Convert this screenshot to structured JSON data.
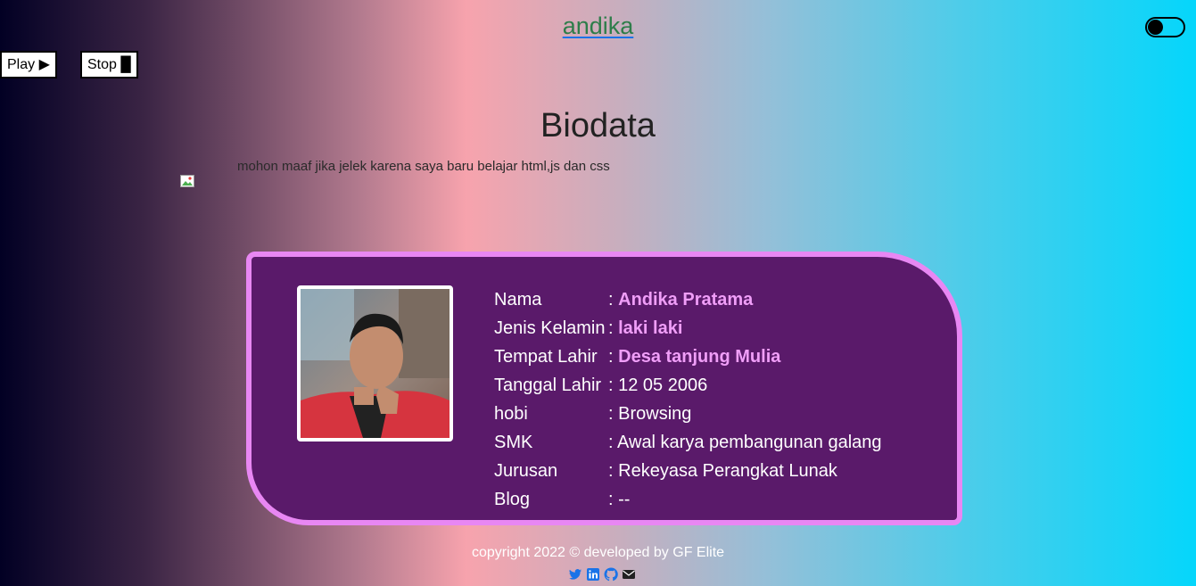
{
  "header": {
    "site_title": "andika"
  },
  "controls": {
    "play_label": "Play ▶",
    "stop_label": "Stop █"
  },
  "page": {
    "heading": "Biodata",
    "note": "mohon maaf jika jelek karena saya baru belajar html,js dan css"
  },
  "biodata": [
    {
      "label": "Nama",
      "value": "Andika Pratama",
      "highlight": true
    },
    {
      "label": "Jenis Kelamin",
      "value": "laki laki",
      "highlight": true
    },
    {
      "label": "Tempat Lahir",
      "value": "Desa tanjung Mulia",
      "highlight": true
    },
    {
      "label": "Tanggal Lahir",
      "value": "12 05 2006",
      "highlight": false
    },
    {
      "label": "hobi",
      "value": "Browsing",
      "highlight": false
    },
    {
      "label": "SMK",
      "value": "Awal karya pembangunan galang",
      "highlight": false
    },
    {
      "label": "Jurusan",
      "value": "Rekeyasa Perangkat Lunak",
      "highlight": false
    },
    {
      "label": "Blog",
      "value": "--",
      "highlight": false
    }
  ],
  "footer": {
    "copyright": "copyright 2022 © developed by GF Elite"
  },
  "social_icons": [
    "twitter-icon",
    "linkedin-icon",
    "github-icon",
    "envelope-icon"
  ],
  "colors": {
    "card_bg": "#5a1a6a",
    "card_border": "#e887f3",
    "highlight": "#f09ef8"
  }
}
